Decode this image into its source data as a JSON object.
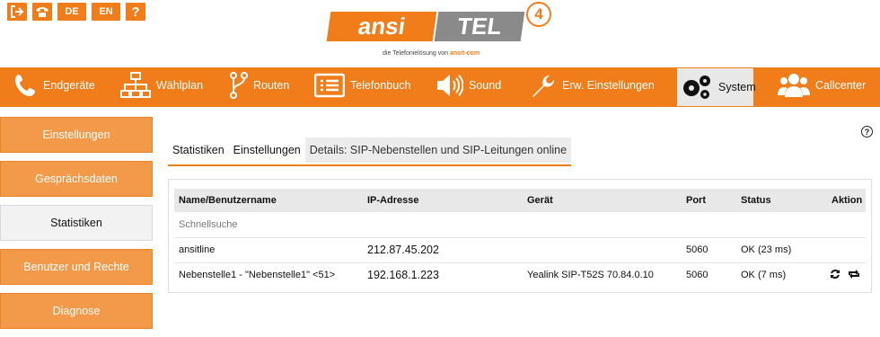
{
  "topbar": {
    "icons": [
      "logout-icon",
      "phone-icon"
    ],
    "lang_de": "DE",
    "lang_en": "EN",
    "help_label": "?"
  },
  "logo": {
    "left_word": "ansi",
    "right_word": "TEL",
    "version": "4",
    "tagline_prefix": "die Telefonielösung von",
    "tagline_brand": "ansit-com"
  },
  "nav": {
    "items": [
      {
        "label": "Endgeräte",
        "icon": "phone-icon"
      },
      {
        "label": "Wählplan",
        "icon": "sitemap-icon"
      },
      {
        "label": "Routen",
        "icon": "route-icon"
      },
      {
        "label": "Telefonbuch",
        "icon": "phonebook-icon"
      },
      {
        "label": "Sound",
        "icon": "speaker-icon"
      },
      {
        "label": "Erw. Einstellungen",
        "icon": "wrench-icon"
      },
      {
        "label": "System",
        "icon": "gears-icon",
        "active": true
      },
      {
        "label": "Callcenter",
        "icon": "users-icon"
      }
    ]
  },
  "sidebar": {
    "items": [
      {
        "label": "Einstellungen"
      },
      {
        "label": "Gesprächsdaten"
      },
      {
        "label": "Statistiken",
        "active": true
      },
      {
        "label": "Benutzer und Rechte"
      },
      {
        "label": "Diagnose"
      }
    ]
  },
  "tabs": [
    {
      "label": "Statistiken"
    },
    {
      "label": "Einstellungen"
    },
    {
      "label": "Details: SIP-Nebenstellen und SIP-Leitungen online",
      "active": true
    }
  ],
  "help_icon": "?",
  "table": {
    "columns": [
      "Name/Benutzername",
      "IP-Adresse",
      "Gerät",
      "Port",
      "Status",
      "Aktion"
    ],
    "quick_search": "Schnellsuche",
    "rows": [
      {
        "name": "ansitline",
        "ip": "212.87.45.202",
        "device": "",
        "port": "5060",
        "status": "OK (23 ms)"
      },
      {
        "name": "Nebenstelle1 - \"Nebenstelle1\" <51>",
        "ip": "192.168.1.223",
        "device": "Yealink SIP-T52S 70.84.0.10",
        "port": "5060",
        "status": "OK (7 ms)"
      }
    ]
  },
  "colors": {
    "accent": "#f07d1a",
    "sidebar": "#f39a4a"
  }
}
